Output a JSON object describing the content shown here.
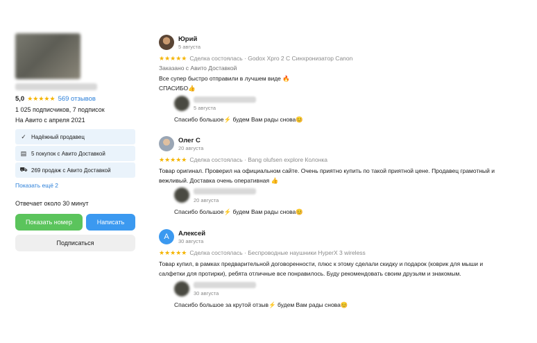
{
  "seller": {
    "rating": "5,0",
    "stars": "★★★★★",
    "reviews_link": "569 отзывов",
    "followers": "1 025 подписчиков, 7 подписок",
    "since": "На Авито с апреля 2021",
    "badges": [
      {
        "icon": "check-circle-icon",
        "label": "Надёжный продавец"
      },
      {
        "icon": "doc-icon",
        "label": "5 покупок с Авито Доставкой"
      },
      {
        "icon": "truck-icon",
        "label": "269 продаж с Авито Доставкой"
      }
    ],
    "show_more": "Показать ещё 2",
    "reply_time": "Отвечает около 30 минут",
    "btn_phone": "Показать номер",
    "btn_write": "Написать",
    "btn_subscribe": "Подписаться"
  },
  "reviews": [
    {
      "author": "Юрий",
      "date": "5 августа",
      "stars": "★★★★★",
      "meta": "Сделка состоялась · Godox Xpro 2 C Синхронизатор Canon",
      "sub": "Заказано с Авито Доставкой",
      "text_line1": "Все супер быстро отправили в лучшем виде 🔥",
      "text_line2": "СПАСИБО👍",
      "reply_date": "5 августа",
      "reply_text": "Спасибо большое⚡ будем Вам рады снова😊"
    },
    {
      "author": "Олег С",
      "date": "20 августа",
      "stars": "★★★★★",
      "meta": "Сделка состоялась · Bang olufsen explore Колонка",
      "text_line1": "Товар оригинал. Проверил на официальном сайте. Очень приятно купить по такой приятной цене. Продавец грамотный и",
      "text_line2": "вежливый. Доставка очень оперативная 👍",
      "reply_date": "20 августа",
      "reply_text": "Спасибо большое⚡ будем Вам рады снова😊"
    },
    {
      "author": "Алексей",
      "avatar_letter": "А",
      "date": "30 августа",
      "stars": "★★★★★",
      "meta": "Сделка состоялась · Беспроводные наушники HyperX 3 wireless",
      "text_line1": "Товар купил, в рамках предварительной договоренности, плюс к этому сделали скидку и подарок (коврик для мыши и",
      "text_line2": "салфетки для протирки), ребята отличные все понравилось. Буду рекомендовать своим друзьям и знакомым.",
      "reply_date": "30 августа",
      "reply_text": "Спасибо большое за крутой отзыв⚡ будем Вам рады снова😊"
    }
  ]
}
